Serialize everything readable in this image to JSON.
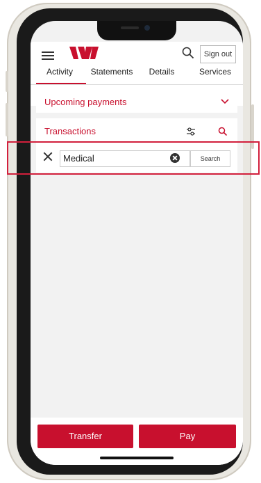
{
  "header": {
    "sign_out_label": "Sign out"
  },
  "tabs": [
    {
      "label": "Activity"
    },
    {
      "label": "Statements"
    },
    {
      "label": "Details"
    },
    {
      "label": "Services"
    }
  ],
  "upcoming": {
    "title": "Upcoming payments"
  },
  "transactions": {
    "title": "Transactions",
    "search_value": "Medical",
    "search_button": "Search"
  },
  "actions": {
    "transfer": "Transfer",
    "pay": "Pay"
  },
  "colors": {
    "accent": "#c8102e",
    "highlight": "#d21f3c"
  },
  "icons": [
    "menu-icon",
    "westpac-logo",
    "search-icon",
    "chevron-down-icon",
    "filter-icon",
    "close-icon",
    "clear-input-icon"
  ]
}
